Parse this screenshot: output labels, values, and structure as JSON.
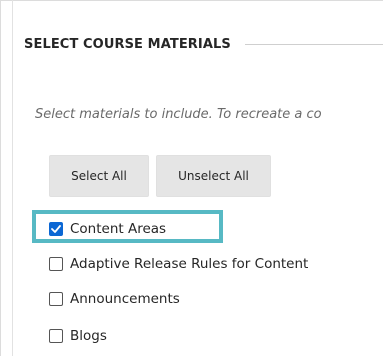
{
  "section": {
    "title": "SELECT COURSE MATERIALS",
    "instructions": "Select materials to include. To recreate a co"
  },
  "buttons": {
    "select_all": "Select All",
    "unselect_all": "Unselect All"
  },
  "options": [
    {
      "label": "Content Areas",
      "checked": true
    },
    {
      "label": "Adaptive Release Rules for Content",
      "checked": false
    },
    {
      "label": "Announcements",
      "checked": false
    },
    {
      "label": "Blogs",
      "checked": false
    }
  ],
  "colors": {
    "highlight": "#57b9c4",
    "checkbox_checked": "#0b67d4"
  },
  "icons": {
    "checked": "checkmark-icon"
  }
}
